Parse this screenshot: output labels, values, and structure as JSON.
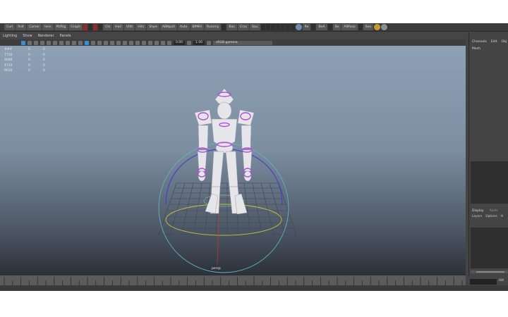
{
  "shelf": {
    "items": [
      "Curl",
      "Rslt",
      "Camer",
      "lens",
      "Pt/Rig",
      "Graph",
      "",
      "",
      "",
      "",
      "Cls",
      "Hail",
      "Ulth",
      "Hits",
      "Shpe",
      "ABNpoll",
      "Auto",
      "BPMH",
      "Rummy",
      "",
      "Bas",
      "Cros",
      "Sau",
      "",
      "",
      "",
      "",
      "",
      "",
      "",
      "Re",
      "",
      "BeA",
      "",
      "Se",
      "AllPose",
      "",
      "Sea"
    ]
  },
  "panel_menu": {
    "items": [
      "Lighting",
      "Show",
      "Renderer",
      "Panels"
    ]
  },
  "toolbar": {
    "exposure": "0.00",
    "gamma": "1.00",
    "color_space": "sRGB gamma"
  },
  "hud": {
    "rows": [
      {
        "label": "###",
        "a": "0",
        "b": "0"
      },
      {
        "label": "7710",
        "a": "0",
        "b": "0"
      },
      {
        "label": "4666",
        "a": "0",
        "b": "0"
      },
      {
        "label": "4710",
        "a": "0",
        "b": "0"
      },
      {
        "label": "9010",
        "a": "0",
        "b": "0"
      }
    ]
  },
  "viewport": {
    "camera_label": "persp"
  },
  "right_panel": {
    "tabs": [
      "Channels",
      "Edit",
      "Obj"
    ],
    "mesh_label": "Mesh",
    "lower_tabs": [
      "Display",
      "Anim"
    ],
    "sub_tabs": [
      "Layers",
      "Options",
      "H"
    ]
  },
  "timeline": {
    "range_label": "l44"
  },
  "colors": {
    "purple_joint": "#b34dd8",
    "manip_blue": "#3b3bcf",
    "manip_yellow": "#c9c43a",
    "manip_cyan": "#5fb3c7",
    "axis_red": "#c0392b"
  }
}
